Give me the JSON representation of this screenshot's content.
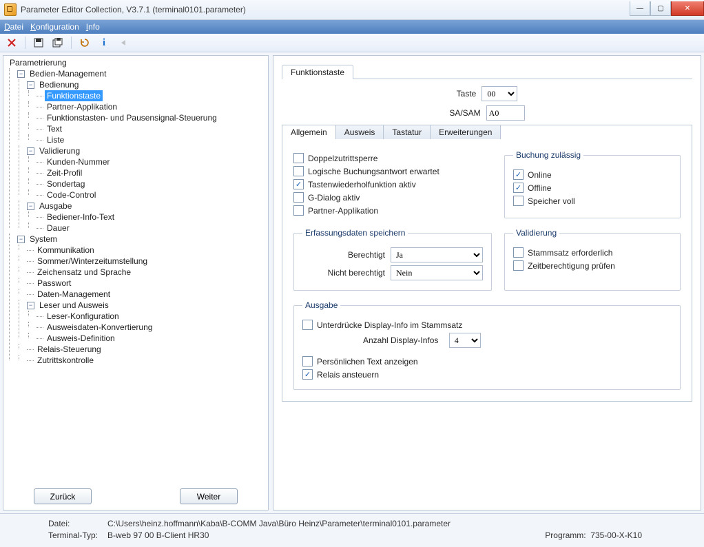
{
  "window": {
    "title": "Parameter Editor Collection, V3.7.1 (terminal0101.parameter)"
  },
  "menu": {
    "file": "Datei",
    "config": "Konfiguration",
    "info": "Info"
  },
  "tree": {
    "root": "Parametrierung",
    "bm": "Bedien-Management",
    "bedienung": "Bedienung",
    "funktionstaste": "Funktionstaste",
    "partnerapp": "Partner-Applikation",
    "fkt_pause": "Funktionstasten- und Pausensignal-Steuerung",
    "text": "Text",
    "liste": "Liste",
    "validierung": "Validierung",
    "kundennr": "Kunden-Nummer",
    "zeitprofil": "Zeit-Profil",
    "sondertag": "Sondertag",
    "codecontrol": "Code-Control",
    "ausgabe": "Ausgabe",
    "bedinfo": "Bediener-Info-Text",
    "dauer": "Dauer",
    "system": "System",
    "komm": "Kommunikation",
    "swz": "Sommer/Winterzeitumstellung",
    "zus": "Zeichensatz und Sprache",
    "pwd": "Passwort",
    "dm": "Daten-Management",
    "lua": "Leser und Ausweis",
    "leserkonf": "Leser-Konfiguration",
    "auswkonv": "Ausweisdaten-Konvertierung",
    "auswdef": "Ausweis-Definition",
    "relais": "Relais-Steuerung",
    "zutritt": "Zutrittskontrolle"
  },
  "nav": {
    "back": "Zurück",
    "next": "Weiter"
  },
  "panel": {
    "tab": "Funktionstaste",
    "taste_label": "Taste",
    "taste_value": "00",
    "sasam_label": "SA/SAM",
    "sasam_value": "A0",
    "subtabs": {
      "allg": "Allgemein",
      "ausweis": "Ausweis",
      "tastatur": "Tastatur",
      "erw": "Erweiterungen"
    },
    "flags": {
      "doppel": "Doppelzutrittsperre",
      "logbuch": "Logische Buchungsantwort erwartet",
      "tastwdh": "Tastenwiederholfunktion aktiv",
      "gdialog": "G-Dialog aktiv",
      "partner": "Partner-Applikation"
    },
    "buchung": {
      "legend": "Buchung zulässig",
      "online": "Online",
      "offline": "Offline",
      "speicher": "Speicher voll"
    },
    "erf": {
      "legend": "Erfassungsdaten speichern",
      "ber": "Berechtigt",
      "ber_val": "Ja",
      "nber": "Nicht berechtigt",
      "nber_val": "Nein"
    },
    "valid": {
      "legend": "Validierung",
      "stamm": "Stammsatz erforderlich",
      "zeit": "Zeitberechtigung prüfen"
    },
    "out": {
      "legend": "Ausgabe",
      "unter": "Unterdrücke Display-Info im Stammsatz",
      "anz": "Anzahl Display-Infos",
      "anz_val": "4",
      "pers": "Persönlichen Text anzeigen",
      "rel": "Relais ansteuern"
    }
  },
  "status": {
    "file_lbl": "Datei:",
    "file_val": "C:\\Users\\heinz.hoffmann\\Kaba\\B-COMM Java\\Büro Heinz\\Parameter\\terminal0101.parameter",
    "term_lbl": "Terminal-Typ:",
    "term_val": "B-web 97 00 B-Client HR30",
    "prog_lbl": "Programm:",
    "prog_val": "735-00-X-K10"
  }
}
